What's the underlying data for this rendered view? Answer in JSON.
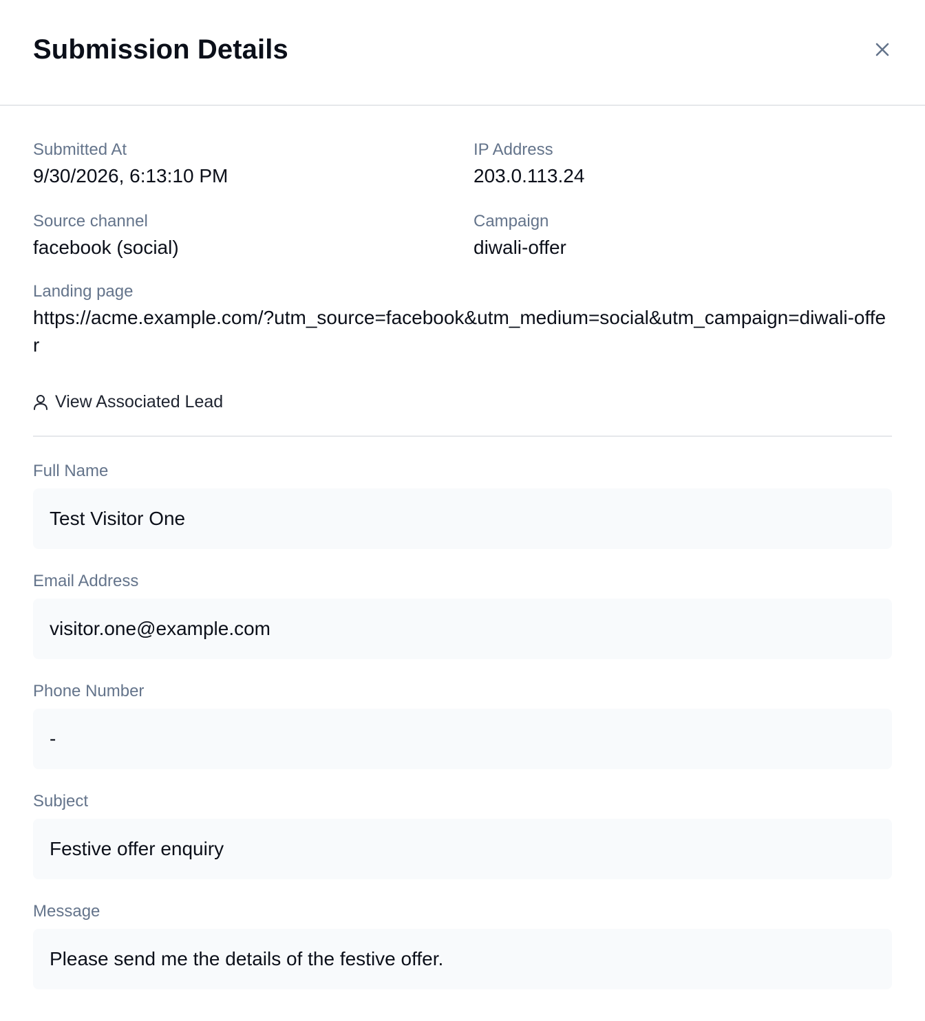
{
  "modal": {
    "title": "Submission Details",
    "close_icon": "close-icon"
  },
  "meta": {
    "submitted_at": {
      "label": "Submitted At",
      "value": "9/30/2026, 6:13:10 PM"
    },
    "ip_address": {
      "label": "IP Address",
      "value": "203.0.113.24"
    },
    "source_channel": {
      "label": "Source channel",
      "value": "facebook (social)"
    },
    "campaign": {
      "label": "Campaign",
      "value": "diwali-offer"
    },
    "landing_page": {
      "label": "Landing page",
      "value": "https://acme.example.com/?utm_source=facebook&utm_medium=social&utm_campaign=diwali-offer"
    }
  },
  "lead_link": {
    "icon": "user-icon",
    "label": "View Associated Lead"
  },
  "fields": {
    "full_name": {
      "label": "Full Name",
      "value": "Test Visitor One"
    },
    "email": {
      "label": "Email Address",
      "value": "visitor.one@example.com"
    },
    "phone": {
      "label": "Phone Number",
      "value": "-"
    },
    "subject": {
      "label": "Subject",
      "value": "Festive offer enquiry"
    },
    "message": {
      "label": "Message",
      "value": "Please send me the details of the festive offer."
    }
  }
}
